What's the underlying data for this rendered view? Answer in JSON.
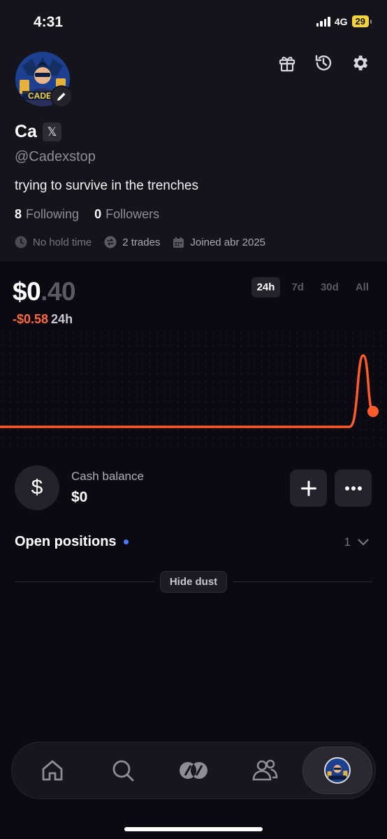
{
  "status": {
    "time": "4:31",
    "network": "4G",
    "battery": "29"
  },
  "header": {
    "icons": [
      "gift-icon",
      "history-icon",
      "settings-icon"
    ]
  },
  "profile": {
    "avatar_text": "CADEX",
    "name": "Ca",
    "x_badge": "𝕏",
    "handle": "@Cadexstop",
    "bio": "trying to survive in the trenches",
    "following_count": "8",
    "following_label": "Following",
    "followers_count": "0",
    "followers_label": "Followers",
    "meta": {
      "hold_time": "No hold time",
      "trades": "2 trades",
      "joined": "Joined abr 2025"
    }
  },
  "portfolio": {
    "balance_main": "$0",
    "balance_dim": ".40",
    "change": "-$0.58",
    "change_period": "24h",
    "timeframes": [
      "24h",
      "7d",
      "30d",
      "All"
    ],
    "active_timeframe": "24h"
  },
  "cash": {
    "label": "Cash balance",
    "value": "$0",
    "icon_symbol": "$"
  },
  "positions": {
    "title": "Open positions",
    "count": "1"
  },
  "hide_dust": "Hide dust",
  "nav": {
    "items": [
      "home",
      "search",
      "markets",
      "social",
      "profile"
    ],
    "active": "profile"
  },
  "colors": {
    "accent": "#ff6a3d",
    "background": "#0b0912",
    "panel": "#15131c",
    "dot": "#4b7dff"
  }
}
